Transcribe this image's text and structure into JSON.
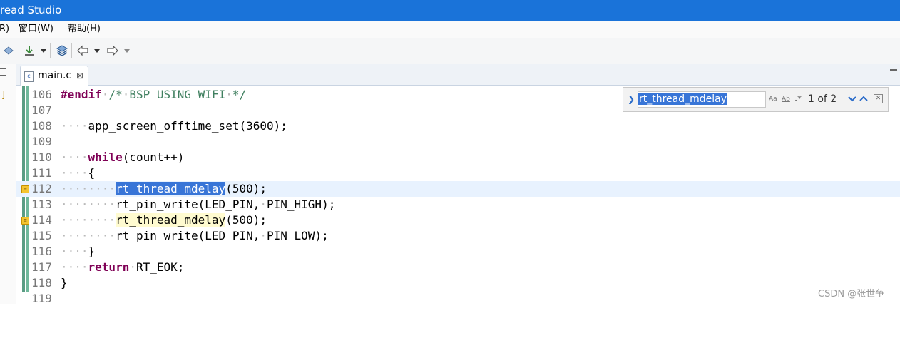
{
  "window": {
    "title": "read Studio"
  },
  "menu": {
    "items": [
      "R)",
      "窗口(W)",
      "帮助(H)"
    ]
  },
  "toolbar": {
    "icons": [
      "tag-icon",
      "download-icon",
      "dropdown-icon",
      "layers-icon",
      "back-arrow-icon",
      "dropdown-icon",
      "forward-arrow-icon",
      "dropdown-icon"
    ]
  },
  "left_panel": {
    "marker": "]"
  },
  "editor_tab": {
    "filename": "main.c",
    "close": "⊠"
  },
  "find_bar": {
    "query": "rt_thread_mdelay",
    "match_case": "Aa",
    "whole_word": "Ab",
    "regex": ".*",
    "match_count": "1 of 2"
  },
  "code": {
    "lines": [
      {
        "n": "106",
        "text": "#endif /* BSP_USING_WIFI */"
      },
      {
        "n": "107",
        "text": ""
      },
      {
        "n": "108",
        "text": "    app_screen_offtime_set(3600);"
      },
      {
        "n": "109",
        "text": ""
      },
      {
        "n": "110",
        "text": "    while(count++)"
      },
      {
        "n": "111",
        "text": "    {"
      },
      {
        "n": "112",
        "text": "        rt_thread_mdelay(500);"
      },
      {
        "n": "113",
        "text": "        rt_pin_write(LED_PIN, PIN_HIGH);"
      },
      {
        "n": "114",
        "text": "        rt_thread_mdelay(500);"
      },
      {
        "n": "115",
        "text": "        rt_pin_write(LED_PIN, PIN_LOW);"
      },
      {
        "n": "116",
        "text": "    }"
      },
      {
        "n": "117",
        "text": "    return RT_EOK;"
      },
      {
        "n": "118",
        "text": "}"
      },
      {
        "n": "119",
        "text": ""
      }
    ],
    "current_line": "112",
    "selected_word": "rt_thread_mdelay"
  },
  "watermark": {
    "text": "CSDN @张世争"
  },
  "colors": {
    "titlebar": "#1a73d9",
    "keyword": "#7f0055",
    "comment": "#3f7f5f",
    "selection": "#3875d7",
    "occurrence": "#fffbd0",
    "current_line": "#e8f2fe"
  }
}
